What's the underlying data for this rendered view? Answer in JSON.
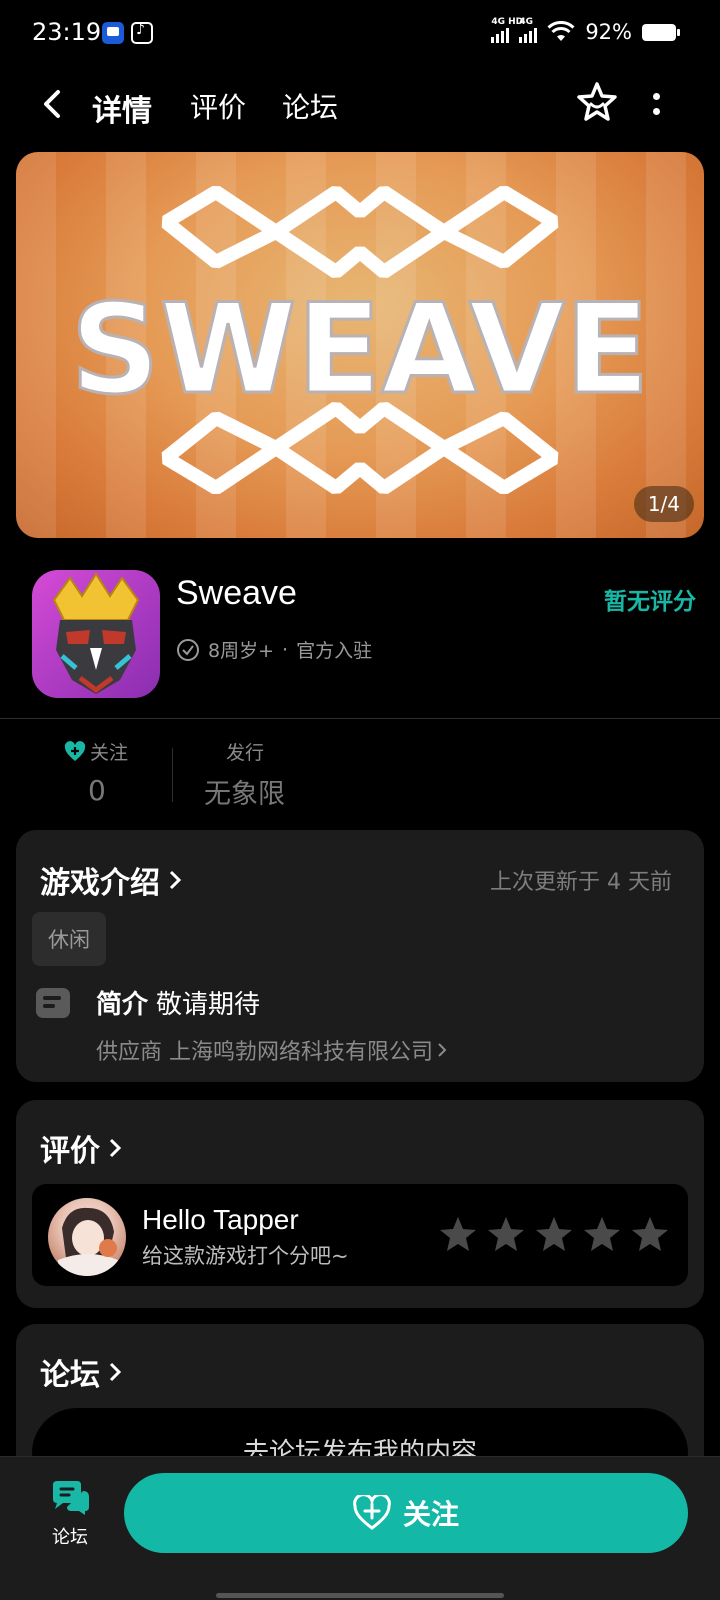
{
  "status_bar": {
    "time": "23:19",
    "battery": "92%",
    "network_1": "4G HD",
    "network_2": "4G"
  },
  "top_nav": {
    "tabs": [
      {
        "label": "详情",
        "active": true
      },
      {
        "label": "评价",
        "active": false
      },
      {
        "label": "论坛",
        "active": false
      }
    ],
    "icons": [
      "chevron-left-icon",
      "star-badge-icon",
      "more-vertical-icon"
    ]
  },
  "banner": {
    "counter": "1/4",
    "logo_text": "SWEAVE"
  },
  "app": {
    "name": "Sweave",
    "age_rating": "8周岁+",
    "official": "官方入驻",
    "rating": "暂无评分"
  },
  "stats": {
    "follow_label": "关注",
    "follow_value": "0",
    "publisher_label": "发行",
    "publisher_value": "无象限"
  },
  "intro": {
    "title": "游戏介绍",
    "updated": "上次更新于 4 天前",
    "tag": "休闲",
    "summary_label": "简介",
    "summary_text": "敬请期待",
    "supplier": "供应商 上海鸣勃网络科技有限公司"
  },
  "review": {
    "title": "评价",
    "user_name": "Hello Tapper",
    "hint": "给这款游戏打个分吧~",
    "stars": 5
  },
  "forum": {
    "title": "论坛",
    "post_button": "去论坛发布我的内容"
  },
  "bottom_bar": {
    "forum_label": "论坛",
    "follow_label": "关注"
  },
  "colors": {
    "accent": "#14b8a6",
    "background": "#000000",
    "card": "#1c1c1c"
  }
}
